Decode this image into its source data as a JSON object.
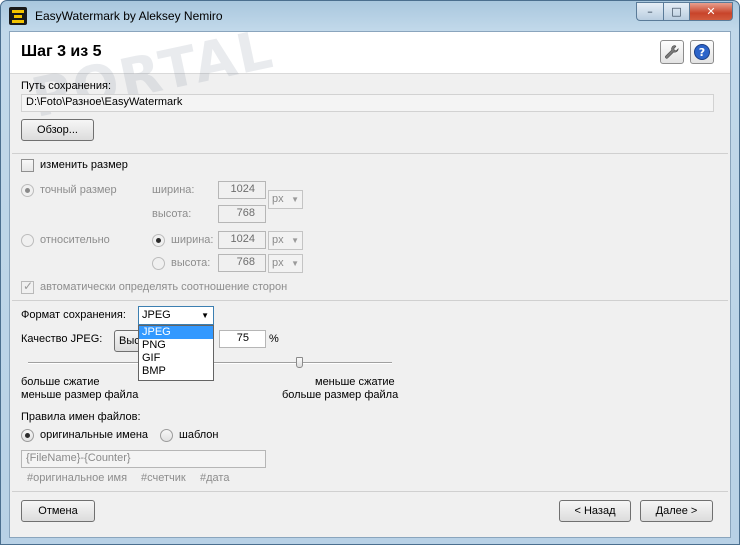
{
  "window": {
    "title": "EasyWatermark by Aleksey Nemiro",
    "controls": {
      "minimize": "–",
      "maximize": "□",
      "close": "✕"
    }
  },
  "header": {
    "step_title": "Шаг 3 из 5",
    "icons": [
      "wrench-icon",
      "help-icon"
    ],
    "help_glyph": "?"
  },
  "save_path": {
    "label": "Путь сохранения:",
    "value": "D:\\Foto\\Разное\\EasyWatermark",
    "browse_label": "Обзор..."
  },
  "resize": {
    "checkbox_label": "изменить размер",
    "exact_label": "точный размер",
    "relative_label": "относительно",
    "width_label": "ширина:",
    "height_label": "высота:",
    "exact_width": "1024",
    "exact_height": "768",
    "rel_width": "1024",
    "rel_height": "768",
    "unit": "px",
    "aspect_label": "автоматически определять соотношение сторон"
  },
  "format": {
    "label": "Формат сохранения:",
    "selected": "JPEG",
    "options": [
      "JPEG",
      "PNG",
      "GIF",
      "BMP"
    ]
  },
  "quality": {
    "label": "Качество JPEG:",
    "preset_partial": "Выс",
    "value": "75",
    "unit": "%",
    "left_line1": "больше сжатие",
    "left_line2": "меньше размер файла",
    "right_line1": "меньше сжатие",
    "right_line2": "больше размер файла"
  },
  "naming": {
    "label": "Правила имен файлов:",
    "original_label": "оригинальные имена",
    "template_label": "шаблон",
    "template_value": "{FileName}-{Counter}",
    "tokens": [
      "#оригинальное имя",
      "#счетчик",
      "#дата"
    ]
  },
  "footer": {
    "cancel": "Отмена",
    "back": "< Назад",
    "next": "Далее >"
  },
  "watermark_text": "PORTAL",
  "colors": {
    "selection": "#3399ff",
    "help_blue": "#2c64c9",
    "close_red": "#c8442a"
  }
}
